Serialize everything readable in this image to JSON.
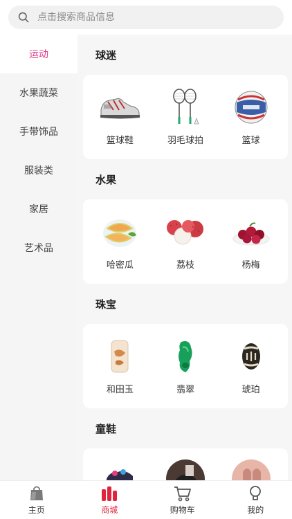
{
  "search": {
    "placeholder": "点击搜索商品信息",
    "icon": "search-icon"
  },
  "sidebar": {
    "active_color": "#e03c8a",
    "items": [
      {
        "label": "运动",
        "active": true
      },
      {
        "label": "水果蔬菜"
      },
      {
        "label": "手带饰品"
      },
      {
        "label": "服装类"
      },
      {
        "label": "家居"
      },
      {
        "label": "艺术品"
      }
    ]
  },
  "sections": [
    {
      "title": "球迷",
      "products": [
        {
          "label": "篮球鞋",
          "icon": "sneaker-icon"
        },
        {
          "label": "羽毛球拍",
          "icon": "badminton-racket-icon"
        },
        {
          "label": "篮球",
          "icon": "basketball-icon"
        }
      ]
    },
    {
      "title": "水果",
      "products": [
        {
          "label": "哈密瓜",
          "icon": "melon-icon"
        },
        {
          "label": "荔枝",
          "icon": "lychee-icon"
        },
        {
          "label": "杨梅",
          "icon": "bayberry-icon"
        }
      ]
    },
    {
      "title": "珠宝",
      "products": [
        {
          "label": "和田玉",
          "icon": "jade-pendant-icon"
        },
        {
          "label": "翡翠",
          "icon": "emerald-icon"
        },
        {
          "label": "琥珀",
          "icon": "amber-icon"
        }
      ]
    },
    {
      "title": "童鞋",
      "products": [
        {
          "label": "",
          "icon": "kids-shoe-icon"
        },
        {
          "label": "",
          "icon": "kids-shoe-icon"
        },
        {
          "label": "",
          "icon": "kids-shoe-icon"
        }
      ]
    }
  ],
  "tabbar": {
    "active_color": "#e0243b",
    "items": [
      {
        "label": "主页",
        "icon": "bag-icon"
      },
      {
        "label": "商城",
        "icon": "mall-icon",
        "active": true
      },
      {
        "label": "购物车",
        "icon": "cart-icon"
      },
      {
        "label": "我的",
        "icon": "user-icon"
      }
    ]
  }
}
